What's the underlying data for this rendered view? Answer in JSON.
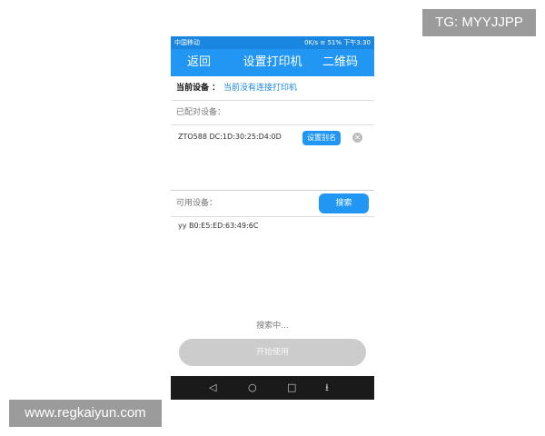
{
  "watermarks": {
    "top_right": "TG: MYYJJPP",
    "bottom_left": "www.regkaiyun.com"
  },
  "status_bar": {
    "carrier": "中国移动",
    "speed": "0K/s",
    "battery": "51%",
    "time": "下午3:30"
  },
  "nav": {
    "back_label": "返回",
    "title": "设置打印机",
    "qr_label": "二维码"
  },
  "current_device": {
    "label": "当前设备 ：",
    "value": "当前没有连接打印机"
  },
  "paired": {
    "label": "已配对设备：",
    "items": [
      {
        "name": "ZTO588 DC:1D:30:25:D4:0D",
        "alias_button": "设置别名"
      }
    ]
  },
  "available": {
    "label": "可用设备：",
    "search_button": "搜索",
    "items": [
      {
        "name": "yy B0:E5:ED:63:49:6C"
      }
    ]
  },
  "searching_text": "搜索中...",
  "start_button": "开始使用",
  "colors": {
    "accent": "#2196f3",
    "nav_bg": "#1a1a1a",
    "disabled": "#cccccc"
  },
  "icons": {
    "close": "close-icon",
    "back": "back-icon",
    "home": "home-icon",
    "recent": "recent-apps-icon",
    "menu": "menu-icon"
  }
}
